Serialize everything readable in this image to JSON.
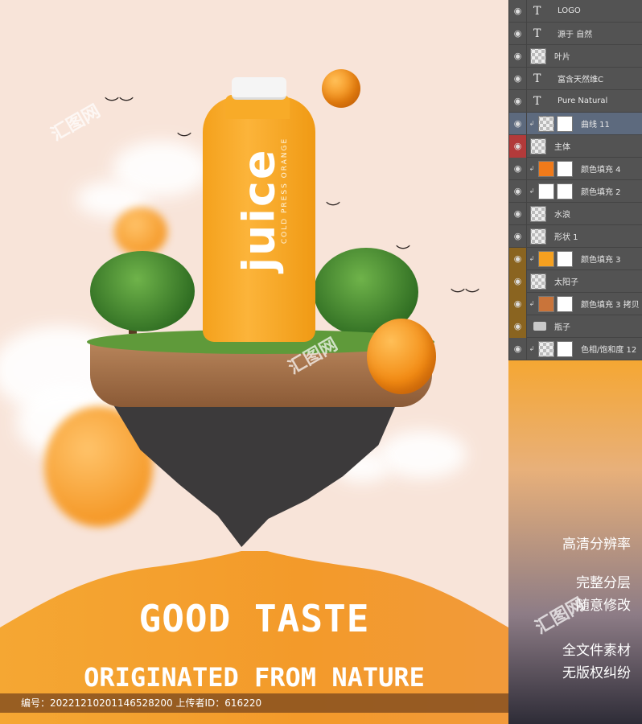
{
  "poster": {
    "bottle": {
      "brand": "juice",
      "tagline": "COLD PRESS ORANGE"
    },
    "headline_1": "GOOD TASTE",
    "headline_2": "ORIGINATED FROM NATURE",
    "watermark": "汇图网",
    "meta": "编号：20221210201146528200 上传者ID：616220"
  },
  "layers_panel": {
    "layers": [
      {
        "name": "LOGO",
        "kind": "type"
      },
      {
        "name": "源于 自然",
        "kind": "type"
      },
      {
        "name": "叶片",
        "kind": "pixel"
      },
      {
        "name": "富含天然维C",
        "kind": "type"
      },
      {
        "name": "Pure Natural",
        "kind": "type"
      },
      {
        "name": "曲线 11",
        "kind": "adjustment",
        "selected": true
      },
      {
        "name": "主体",
        "kind": "pixel",
        "eye_color": "red"
      },
      {
        "name": "颜色填充 4",
        "kind": "fill",
        "fill": "#f07a1a"
      },
      {
        "name": "颜色填充 2",
        "kind": "fill",
        "fill": "#ffffff"
      },
      {
        "name": "水浪",
        "kind": "pixel"
      },
      {
        "name": "形状 1",
        "kind": "pixel"
      },
      {
        "name": "颜色填充 3",
        "kind": "fill",
        "fill": "#f5a020",
        "eye_color": "brown"
      },
      {
        "name": "太阳子",
        "kind": "pixel",
        "eye_color": "brown"
      },
      {
        "name": "颜色填充 3 拷贝",
        "kind": "fill",
        "fill": "#c9743a",
        "eye_color": "brown"
      },
      {
        "name": "瓶子",
        "kind": "group",
        "eye_color": "brown"
      },
      {
        "name": "色相/饱和度 12",
        "kind": "adjustment"
      }
    ]
  },
  "features": [
    "高清分辨率",
    "完整分层",
    "随意修改",
    "全文件素材",
    "无版权纠纷"
  ],
  "colors": {
    "accent": "#f5a733",
    "panel": "#535353",
    "selected_layer": "#5d6a7e"
  }
}
